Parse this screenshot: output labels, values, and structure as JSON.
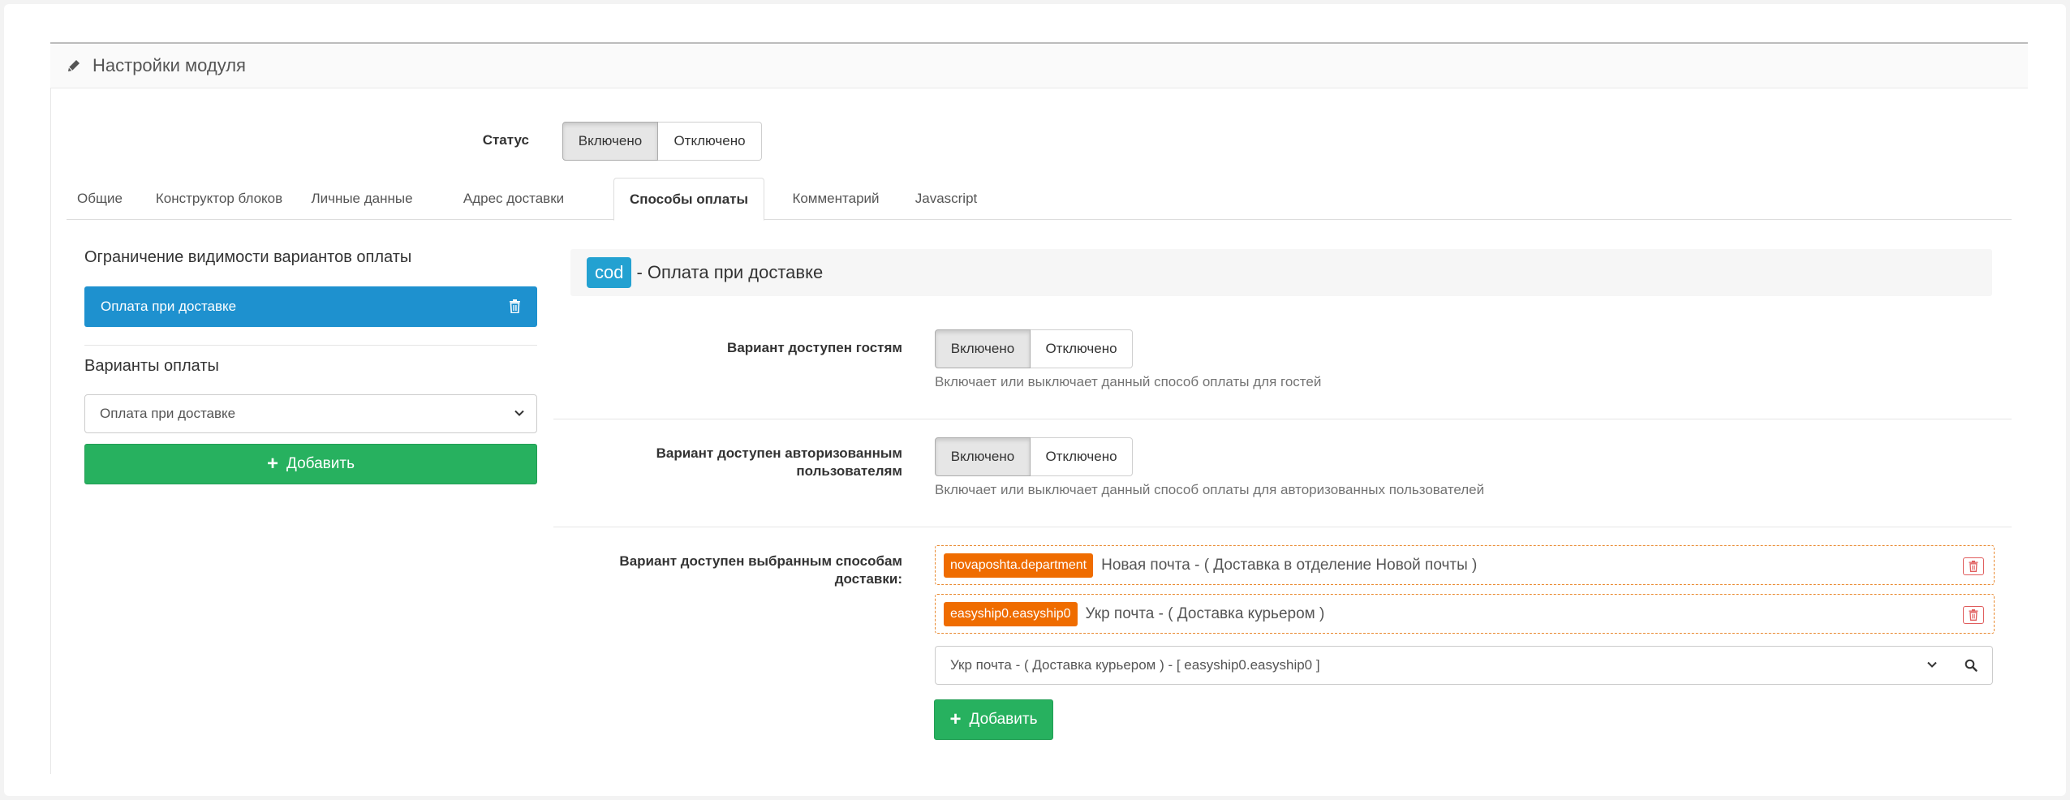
{
  "panel": {
    "title": "Настройки модуля",
    "icon": "pencil-icon"
  },
  "status": {
    "label": "Статус",
    "on": "Включено",
    "off": "Отключено",
    "selected": "on"
  },
  "tabs": [
    {
      "label": "Общие",
      "active": false
    },
    {
      "label": "Конструктор блоков",
      "active": false
    },
    {
      "label": "Личные данные",
      "active": false
    },
    {
      "label": "Адрес доставки",
      "active": false
    },
    {
      "label": "Способы оплаты",
      "active": true
    },
    {
      "label": "Комментарий",
      "active": false
    },
    {
      "label": "Javascript",
      "active": false
    }
  ],
  "sidebar": {
    "restriction_title": "Ограничение видимости вариантов оплаты",
    "selected_item": "Оплата при доставке",
    "variants_title": "Варианты оплаты",
    "variant_select_value": "Оплата при доставке",
    "add_label": "Добавить"
  },
  "payment": {
    "code": "cod",
    "title": "- Оплата при доставке",
    "guests": {
      "label": "Вариант доступен гостям",
      "on": "Включено",
      "off": "Отключено",
      "help": "Включает или выключает данный способ оплаты для гостей"
    },
    "authorized": {
      "label_line1": "Вариант доступен авторизованным",
      "label_line2": "пользователям",
      "on": "Включено",
      "off": "Отключено",
      "help": "Включает или выключает данный способ оплаты для авторизованных пользователей"
    },
    "shipping": {
      "label_line1": "Вариант доступен выбранным способам",
      "label_line2": "доставки:",
      "methods": [
        {
          "code": "novaposhta.department",
          "name": "Новая почта - ( Доставка в отделение Новой почты )"
        },
        {
          "code": "easyship0.easyship0",
          "name": "Укр почта - ( Доставка курьером )"
        }
      ],
      "select_value": "Укр почта - ( Доставка курьером ) - [ easyship0.easyship0 ]",
      "add_label": "Добавить"
    }
  },
  "colors": {
    "primary": "#1e91cf",
    "success": "#27b15f",
    "info": "#23a1d1",
    "warning": "#ef6c00",
    "danger": "#e05d5d"
  }
}
